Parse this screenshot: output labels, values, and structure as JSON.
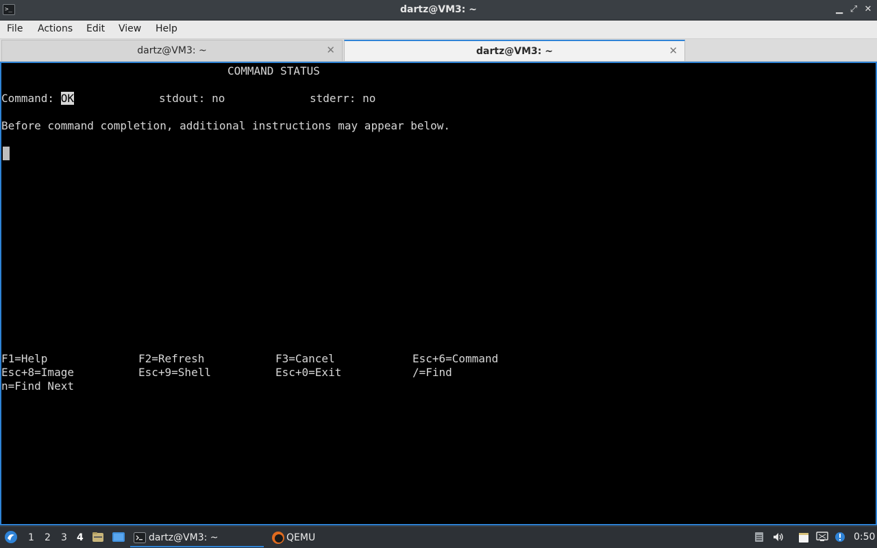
{
  "window": {
    "title": "dartz@VM3: ~",
    "icon": "terminal-icon",
    "controls": [
      "minimize-icon",
      "maximize-icon",
      "close-icon"
    ]
  },
  "menu": {
    "items": [
      "File",
      "Actions",
      "Edit",
      "View",
      "Help"
    ]
  },
  "tabs": [
    {
      "label": "dartz@VM3: ~",
      "active": false
    },
    {
      "label": "dartz@VM3: ~",
      "active": true
    }
  ],
  "terminal": {
    "header": "COMMAND STATUS",
    "command_label": "Command: ",
    "command_value": "OK",
    "stdout": "stdout: no",
    "stderr": "stderr: no",
    "message": "Before command completion, additional instructions may appear below.",
    "keys": [
      [
        "F1=Help",
        "F2=Refresh",
        "F3=Cancel",
        "Esc+6=Command"
      ],
      [
        "Esc+8=Image",
        "Esc+9=Shell",
        "Esc+0=Exit",
        "/=Find"
      ],
      [
        "n=Find Next"
      ]
    ]
  },
  "taskbar": {
    "desktops": [
      "1",
      "2",
      "3",
      "4"
    ],
    "active_desktop": "4",
    "tasks": [
      {
        "label": "dartz@VM3: ~",
        "icon": "terminal-icon",
        "active": true
      },
      {
        "label": "QEMU",
        "icon": "qemu-icon",
        "active": false
      }
    ],
    "clock": "0:50"
  }
}
